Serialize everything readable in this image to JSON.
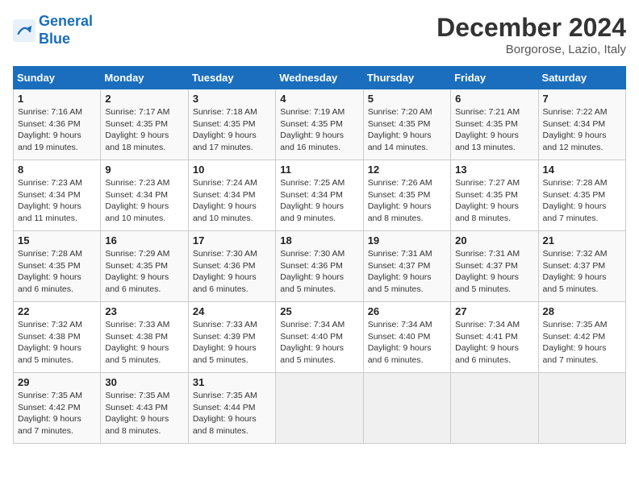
{
  "header": {
    "logo_line1": "General",
    "logo_line2": "Blue",
    "month_year": "December 2024",
    "location": "Borgorose, Lazio, Italy"
  },
  "days_of_week": [
    "Sunday",
    "Monday",
    "Tuesday",
    "Wednesday",
    "Thursday",
    "Friday",
    "Saturday"
  ],
  "weeks": [
    [
      {
        "day": "1",
        "info": "Sunrise: 7:16 AM\nSunset: 4:36 PM\nDaylight: 9 hours\nand 19 minutes."
      },
      {
        "day": "2",
        "info": "Sunrise: 7:17 AM\nSunset: 4:35 PM\nDaylight: 9 hours\nand 18 minutes."
      },
      {
        "day": "3",
        "info": "Sunrise: 7:18 AM\nSunset: 4:35 PM\nDaylight: 9 hours\nand 17 minutes."
      },
      {
        "day": "4",
        "info": "Sunrise: 7:19 AM\nSunset: 4:35 PM\nDaylight: 9 hours\nand 16 minutes."
      },
      {
        "day": "5",
        "info": "Sunrise: 7:20 AM\nSunset: 4:35 PM\nDaylight: 9 hours\nand 14 minutes."
      },
      {
        "day": "6",
        "info": "Sunrise: 7:21 AM\nSunset: 4:35 PM\nDaylight: 9 hours\nand 13 minutes."
      },
      {
        "day": "7",
        "info": "Sunrise: 7:22 AM\nSunset: 4:34 PM\nDaylight: 9 hours\nand 12 minutes."
      }
    ],
    [
      {
        "day": "8",
        "info": "Sunrise: 7:23 AM\nSunset: 4:34 PM\nDaylight: 9 hours\nand 11 minutes."
      },
      {
        "day": "9",
        "info": "Sunrise: 7:23 AM\nSunset: 4:34 PM\nDaylight: 9 hours\nand 10 minutes."
      },
      {
        "day": "10",
        "info": "Sunrise: 7:24 AM\nSunset: 4:34 PM\nDaylight: 9 hours\nand 10 minutes."
      },
      {
        "day": "11",
        "info": "Sunrise: 7:25 AM\nSunset: 4:34 PM\nDaylight: 9 hours\nand 9 minutes."
      },
      {
        "day": "12",
        "info": "Sunrise: 7:26 AM\nSunset: 4:35 PM\nDaylight: 9 hours\nand 8 minutes."
      },
      {
        "day": "13",
        "info": "Sunrise: 7:27 AM\nSunset: 4:35 PM\nDaylight: 9 hours\nand 8 minutes."
      },
      {
        "day": "14",
        "info": "Sunrise: 7:28 AM\nSunset: 4:35 PM\nDaylight: 9 hours\nand 7 minutes."
      }
    ],
    [
      {
        "day": "15",
        "info": "Sunrise: 7:28 AM\nSunset: 4:35 PM\nDaylight: 9 hours\nand 6 minutes."
      },
      {
        "day": "16",
        "info": "Sunrise: 7:29 AM\nSunset: 4:35 PM\nDaylight: 9 hours\nand 6 minutes."
      },
      {
        "day": "17",
        "info": "Sunrise: 7:30 AM\nSunset: 4:36 PM\nDaylight: 9 hours\nand 6 minutes."
      },
      {
        "day": "18",
        "info": "Sunrise: 7:30 AM\nSunset: 4:36 PM\nDaylight: 9 hours\nand 5 minutes."
      },
      {
        "day": "19",
        "info": "Sunrise: 7:31 AM\nSunset: 4:37 PM\nDaylight: 9 hours\nand 5 minutes."
      },
      {
        "day": "20",
        "info": "Sunrise: 7:31 AM\nSunset: 4:37 PM\nDaylight: 9 hours\nand 5 minutes."
      },
      {
        "day": "21",
        "info": "Sunrise: 7:32 AM\nSunset: 4:37 PM\nDaylight: 9 hours\nand 5 minutes."
      }
    ],
    [
      {
        "day": "22",
        "info": "Sunrise: 7:32 AM\nSunset: 4:38 PM\nDaylight: 9 hours\nand 5 minutes."
      },
      {
        "day": "23",
        "info": "Sunrise: 7:33 AM\nSunset: 4:38 PM\nDaylight: 9 hours\nand 5 minutes."
      },
      {
        "day": "24",
        "info": "Sunrise: 7:33 AM\nSunset: 4:39 PM\nDaylight: 9 hours\nand 5 minutes."
      },
      {
        "day": "25",
        "info": "Sunrise: 7:34 AM\nSunset: 4:40 PM\nDaylight: 9 hours\nand 5 minutes."
      },
      {
        "day": "26",
        "info": "Sunrise: 7:34 AM\nSunset: 4:40 PM\nDaylight: 9 hours\nand 6 minutes."
      },
      {
        "day": "27",
        "info": "Sunrise: 7:34 AM\nSunset: 4:41 PM\nDaylight: 9 hours\nand 6 minutes."
      },
      {
        "day": "28",
        "info": "Sunrise: 7:35 AM\nSunset: 4:42 PM\nDaylight: 9 hours\nand 7 minutes."
      }
    ],
    [
      {
        "day": "29",
        "info": "Sunrise: 7:35 AM\nSunset: 4:42 PM\nDaylight: 9 hours\nand 7 minutes."
      },
      {
        "day": "30",
        "info": "Sunrise: 7:35 AM\nSunset: 4:43 PM\nDaylight: 9 hours\nand 8 minutes."
      },
      {
        "day": "31",
        "info": "Sunrise: 7:35 AM\nSunset: 4:44 PM\nDaylight: 9 hours\nand 8 minutes."
      },
      {
        "day": "",
        "info": ""
      },
      {
        "day": "",
        "info": ""
      },
      {
        "day": "",
        "info": ""
      },
      {
        "day": "",
        "info": ""
      }
    ]
  ]
}
